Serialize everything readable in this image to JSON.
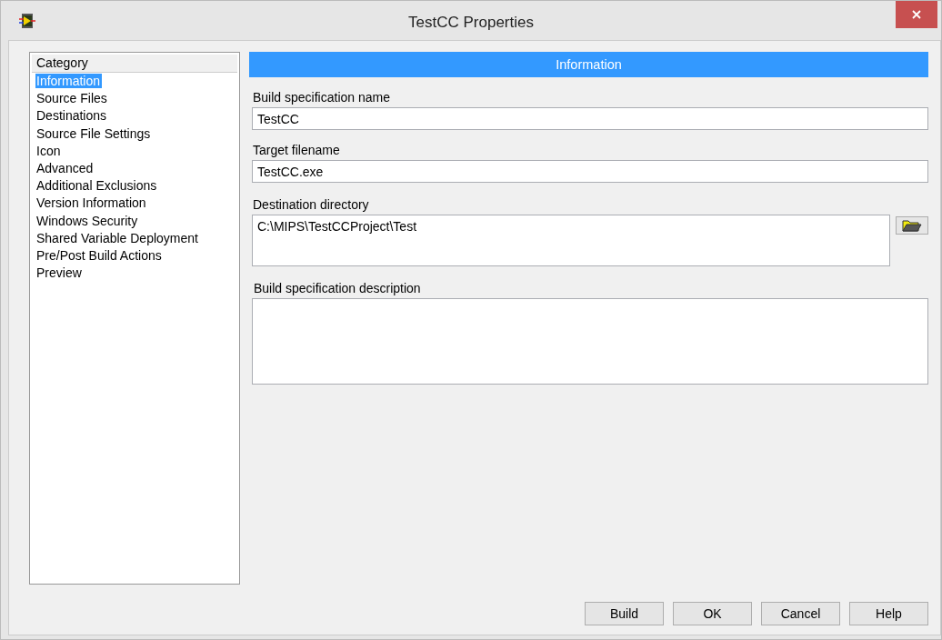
{
  "window": {
    "title": "TestCC Properties"
  },
  "category": {
    "header": "Category",
    "items": [
      {
        "label": "Information",
        "selected": true
      },
      {
        "label": "Source Files",
        "selected": false
      },
      {
        "label": "Destinations",
        "selected": false
      },
      {
        "label": "Source File Settings",
        "selected": false
      },
      {
        "label": "Icon",
        "selected": false
      },
      {
        "label": "Advanced",
        "selected": false
      },
      {
        "label": "Additional Exclusions",
        "selected": false
      },
      {
        "label": "Version Information",
        "selected": false
      },
      {
        "label": "Windows Security",
        "selected": false
      },
      {
        "label": "Shared Variable Deployment",
        "selected": false
      },
      {
        "label": "Pre/Post Build Actions",
        "selected": false
      },
      {
        "label": "Preview",
        "selected": false
      }
    ]
  },
  "panel": {
    "title": "Information",
    "build_name": {
      "label": "Build specification name",
      "value": "TestCC"
    },
    "target_filename": {
      "label": "Target filename",
      "value": "TestCC.exe"
    },
    "destination": {
      "label": "Destination directory",
      "value": "C:\\MIPS\\TestCCProject\\Test"
    },
    "description": {
      "label": "Build specification description"
    }
  },
  "buttons": [
    "Build",
    "OK",
    "Cancel",
    "Help"
  ]
}
